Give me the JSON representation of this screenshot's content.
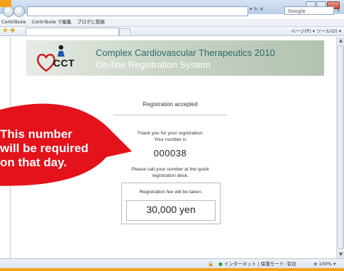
{
  "browser": {
    "search_placeholder": "Google",
    "links_bar": [
      "Contribute",
      "Contribute で編集",
      "ブログに投稿"
    ],
    "command_bar": "ページ(P) ▾  ツール(O) ▾",
    "status_zone": "インターネット | 保護モード: 有効",
    "status_zoom": "100%"
  },
  "page": {
    "logo_text": "CCT",
    "title": "Complex Cardiovascular Therapeutics 2010",
    "subtitle": "On-line Registration System",
    "accepted": "Registration accepted",
    "thanks_line1": "Thank you for your registration.",
    "thanks_line2": "Your number is",
    "number": "000038",
    "call_line1": "Please call your number at the quick",
    "call_line2": "registration desk.",
    "fee_label": "Registration fee will be taken.",
    "fee_amount": "30,000 yen"
  },
  "callout": {
    "text": "This number\nwill be required\non that day.",
    "color": "#e3121b"
  },
  "colors": {
    "frame": "#f3a21c",
    "banner_title": "#2b6b64",
    "callout_red": "#e3121b"
  }
}
